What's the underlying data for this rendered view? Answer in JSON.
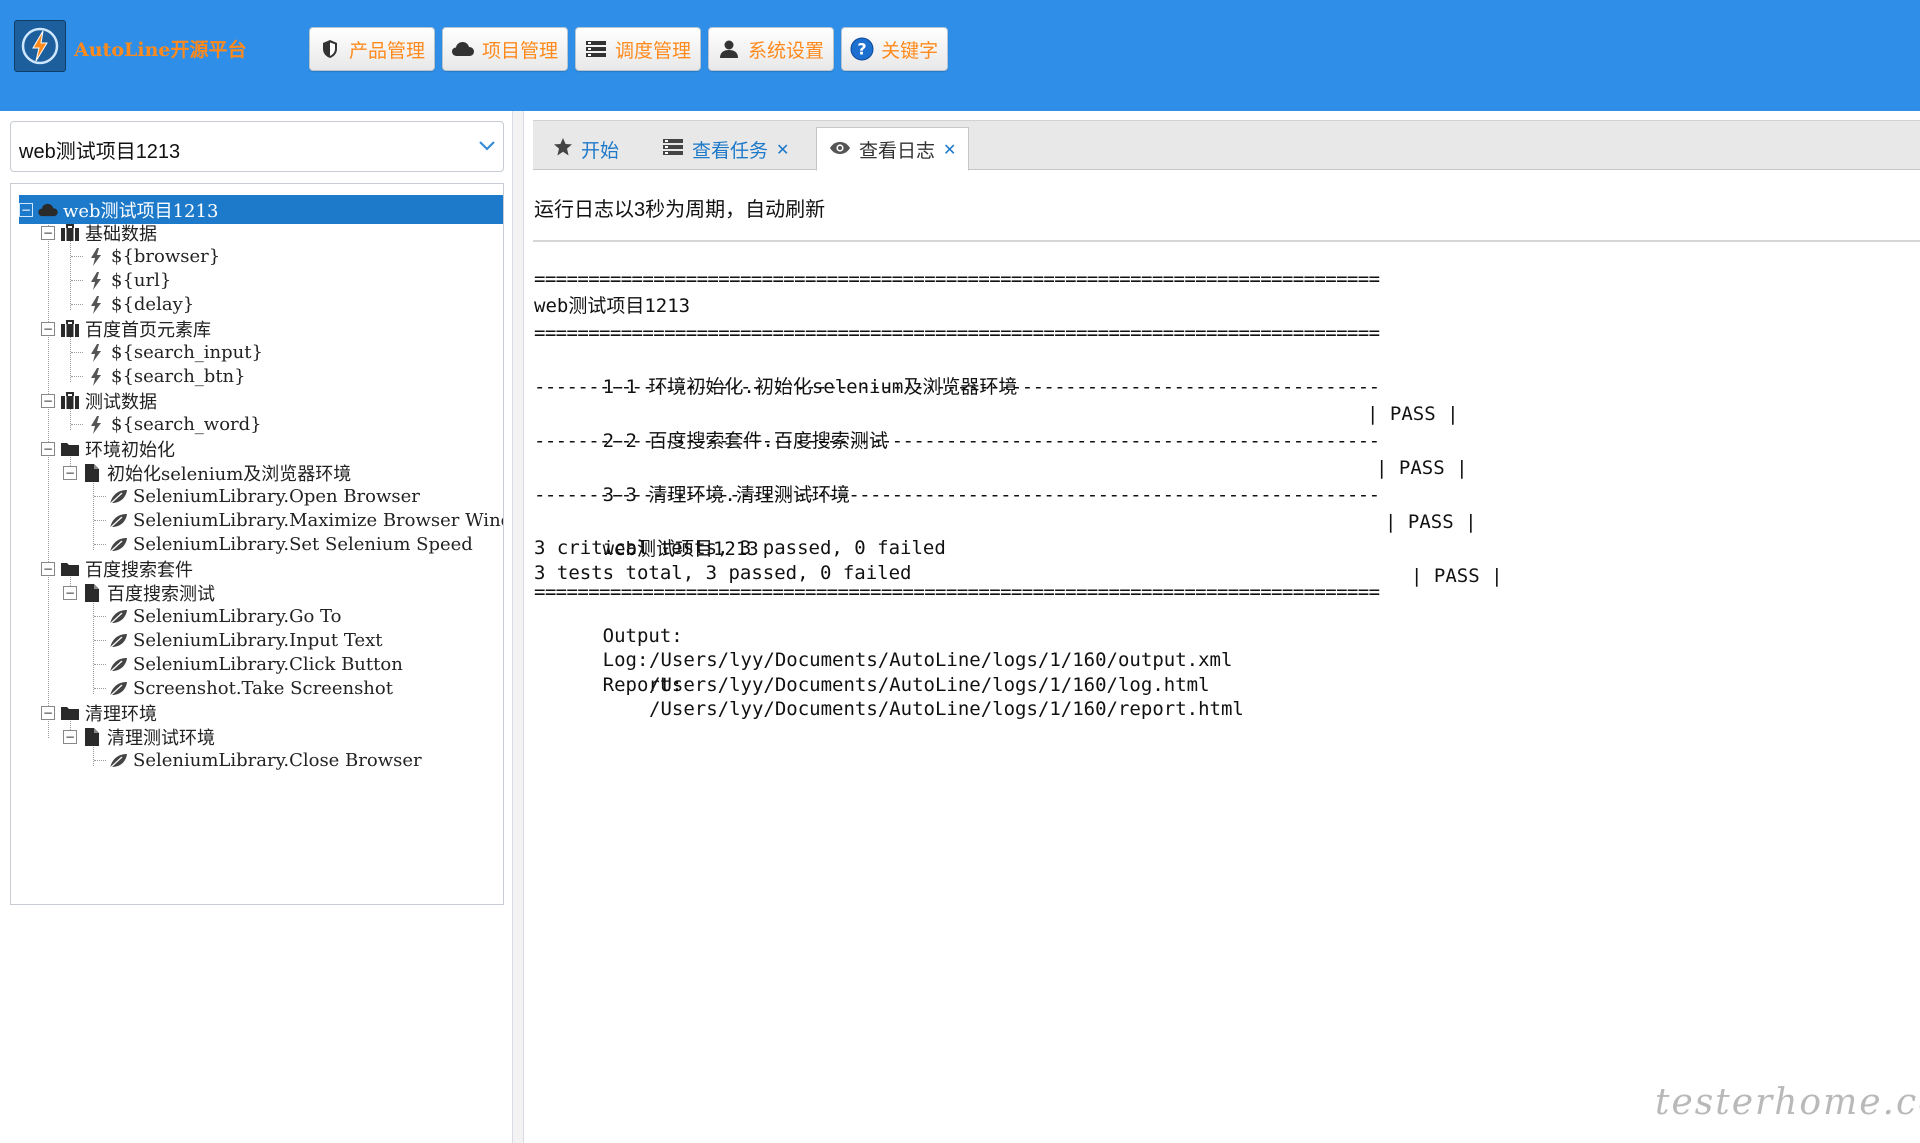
{
  "app": {
    "title": "AutoLine开源平台"
  },
  "nav": [
    {
      "label": "产品管理",
      "icon": "shield-icon"
    },
    {
      "label": "项目管理",
      "icon": "cloud-icon"
    },
    {
      "label": "调度管理",
      "icon": "list-icon"
    },
    {
      "label": "系统设置",
      "icon": "user-icon"
    },
    {
      "label": "关键字",
      "icon": "help-icon"
    }
  ],
  "project_select": {
    "value": "web测试项目1213"
  },
  "tree": {
    "root": "web测试项目1213",
    "nodes": [
      {
        "label": "基础数据",
        "type": "folder-data"
      },
      {
        "label": "${browser}",
        "type": "variable"
      },
      {
        "label": "${url}",
        "type": "variable"
      },
      {
        "label": "${delay}",
        "type": "variable"
      },
      {
        "label": "百度首页元素库",
        "type": "folder-data"
      },
      {
        "label": "${search_input}",
        "type": "variable"
      },
      {
        "label": "${search_btn}",
        "type": "variable"
      },
      {
        "label": "测试数据",
        "type": "folder-data"
      },
      {
        "label": "${search_word}",
        "type": "variable"
      },
      {
        "label": "环境初始化",
        "type": "folder"
      },
      {
        "label": "初始化selenium及浏览器环境",
        "type": "case"
      },
      {
        "label": "SeleniumLibrary.Open Browser",
        "type": "step"
      },
      {
        "label": "SeleniumLibrary.Maximize Browser Window",
        "type": "step"
      },
      {
        "label": "SeleniumLibrary.Set Selenium Speed",
        "type": "step"
      },
      {
        "label": "百度搜索套件",
        "type": "folder"
      },
      {
        "label": "百度搜索测试",
        "type": "case"
      },
      {
        "label": "SeleniumLibrary.Go To",
        "type": "step"
      },
      {
        "label": "SeleniumLibrary.Input Text",
        "type": "step"
      },
      {
        "label": "SeleniumLibrary.Click Button",
        "type": "step"
      },
      {
        "label": "Screenshot.Take Screenshot",
        "type": "step"
      },
      {
        "label": "清理环境",
        "type": "folder"
      },
      {
        "label": "清理测试环境",
        "type": "case"
      },
      {
        "label": "SeleniumLibrary.Close Browser",
        "type": "step"
      }
    ]
  },
  "tabs": [
    {
      "label": "开始",
      "icon": "star-icon",
      "closable": false,
      "active": false
    },
    {
      "label": "查看任务",
      "icon": "list-icon",
      "closable": true,
      "active": false
    },
    {
      "label": "查看日志",
      "icon": "eye-icon",
      "closable": true,
      "active": true
    }
  ],
  "content": {
    "refresh_note": "运行日志以3秒为周期，自动刷新",
    "log": {
      "suite_header": "web测试项目1213",
      "tests": [
        {
          "name": "1-1 环境初始化.初始化selenium及浏览器环境",
          "status": "| PASS |"
        },
        {
          "name": "2-2 百度搜索套件.百度搜索测试",
          "status": "| PASS |"
        },
        {
          "name": "3-3 清理环境.清理测试环境",
          "status": "| PASS |"
        }
      ],
      "summary_name": "web测试项目1213",
      "summary_status": "| PASS |",
      "critical": "3 critical tests, 3 passed, 0 failed",
      "total": "3 tests total, 3 passed, 0 failed",
      "output_label": "Output:",
      "output_path": "/Users/lyy/Documents/AutoLine/logs/1/160/output.xml",
      "log_label": "Log:",
      "log_path": "/Users/lyy/Documents/AutoLine/logs/1/160/log.html",
      "report_label": "Report:",
      "report_path": "/Users/lyy/Documents/AutoLine/logs/1/160/report.html"
    }
  },
  "watermark": "testerhome.com",
  "colors": {
    "header_bg": "#2f8fe8",
    "accent_orange": "#ff8a1c",
    "selected_bg": "#1d79c9",
    "link_blue": "#1d79c9"
  }
}
